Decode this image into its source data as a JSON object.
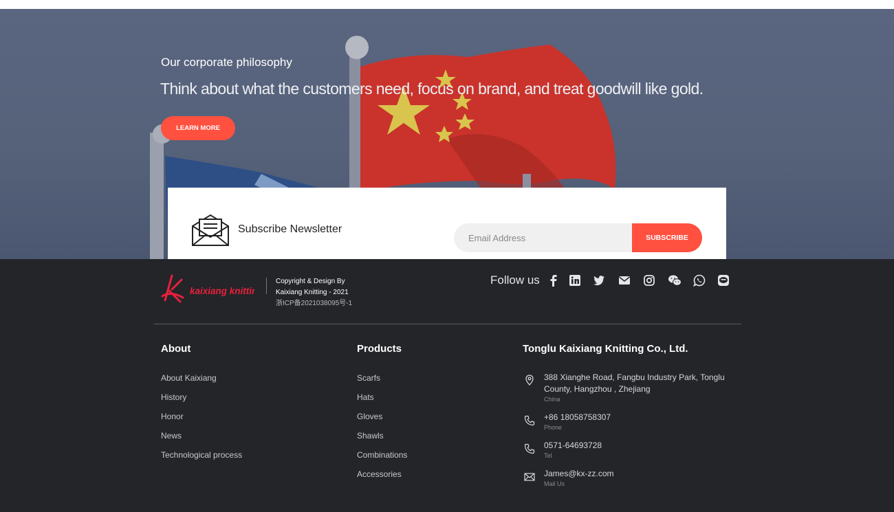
{
  "hero": {
    "title": "Our corporate philosophy",
    "text": "Think about what the customers need, focus on brand, and treat goodwill like gold.",
    "button": "LEARN MORE"
  },
  "newsletter": {
    "icon": "envelope-letter-icon",
    "title": "Subscribe Newsletter",
    "placeholder": "Email Address",
    "button": "SUBSCRIBE"
  },
  "footer": {
    "logo_text": "kaixiang knitting",
    "copyright": {
      "line1": "Copyright & Design By",
      "line2": "Kaixiang Knitting - 2021",
      "icp": "浙ICP备2021038095号-1"
    },
    "follow_label": "Follow us",
    "social": [
      "facebook-icon",
      "linkedin-icon",
      "twitter-icon",
      "email-icon",
      "instagram-icon",
      "wechat-icon",
      "whatsapp-icon",
      "line-icon"
    ],
    "about": {
      "title": "About",
      "links": [
        "About Kaixiang",
        "History",
        "Honor",
        "News",
        "Technological process"
      ]
    },
    "products": {
      "title": "Products",
      "links": [
        "Scarfs",
        "Hats",
        "Gloves",
        "Shawls",
        "Combinations",
        "Accessories"
      ]
    },
    "company": {
      "title": "Tonglu Kaixiang Knitting Co., Ltd.",
      "address": "388 Xianghe Road, Fangbu Industry Park, Tonglu County, Hangzhou , Zhejiang",
      "address_sub": "China",
      "phone": "+86 18058758307",
      "phone_sub": "Phone",
      "tel": "0571-64693728",
      "tel_sub": "Tel",
      "email": "James@kx-zz.com",
      "email_sub": "Mail Us"
    }
  },
  "colors": {
    "accent": "#ff5040",
    "footer_bg": "#232529",
    "hero_overlay": "#56627a"
  }
}
